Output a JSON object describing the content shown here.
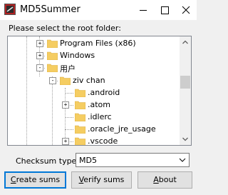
{
  "window": {
    "title": "MD5Summer",
    "icon": "md5summer-app-icon",
    "controls": [
      "minimize-icon",
      "maximize-icon",
      "close-icon"
    ]
  },
  "prompt": "Please select the root folder:",
  "tree": {
    "nodes": [
      {
        "label": "Program Files (x86)",
        "expander": "+"
      },
      {
        "label": "Windows",
        "expander": "+"
      },
      {
        "label": "用户",
        "expander": "-"
      },
      {
        "label": "ziv chan",
        "expander": "-"
      },
      {
        "label": ".android",
        "expander": ""
      },
      {
        "label": ".atom",
        "expander": "+"
      },
      {
        "label": ".idlerc",
        "expander": ""
      },
      {
        "label": ".oracle_jre_usage",
        "expander": ""
      },
      {
        "label": ".vscode",
        "expander": "+"
      }
    ]
  },
  "checksum": {
    "label": "Checksum type:",
    "value": "MD5"
  },
  "buttons": {
    "create_prefix": "C",
    "create_rest": "reate sums",
    "verify_prefix": "V",
    "verify_rest": "erify sums",
    "about_prefix": "A",
    "about_rest": "bout"
  },
  "colors": {
    "folder": "#f5cd62",
    "focus_border": "#0078d7",
    "scroll_thumb": "#cdcdcd"
  }
}
